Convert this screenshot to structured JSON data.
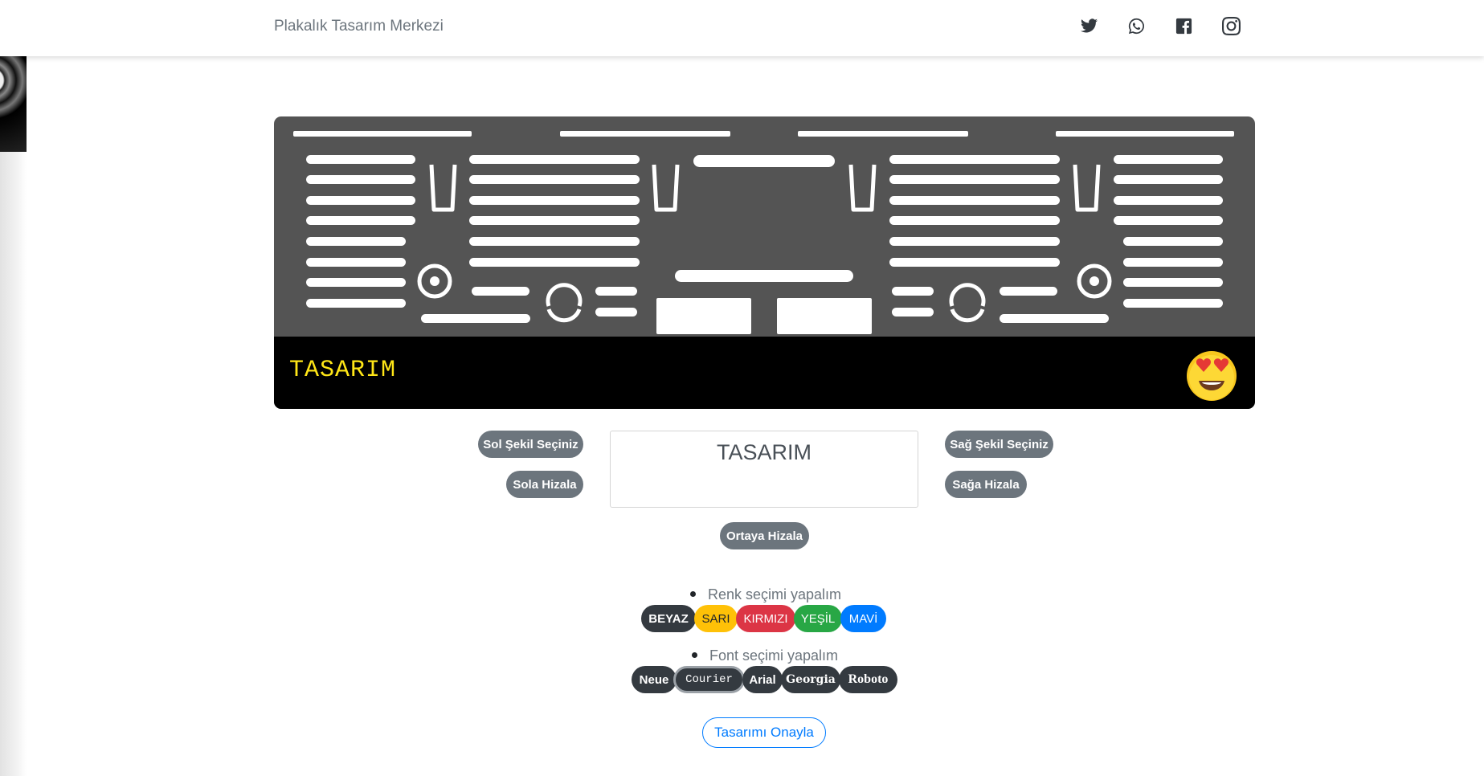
{
  "brand": "Plakalık Tasarım Merkezi",
  "social": [
    "twitter-icon",
    "whatsapp-icon",
    "facebook-icon",
    "instagram-icon"
  ],
  "plate": {
    "text": "TASARIM",
    "text_color": "#ffe617",
    "frame_color": "#545454",
    "strip_color": "#000000",
    "emoji": "heart-eyes-emoji"
  },
  "controls": {
    "left_shape": "Sol Şekil Seçiniz",
    "right_shape": "Sağ Şekil Seçiniz",
    "align_left": "Sola Hizala",
    "align_right": "Sağa Hizala",
    "align_center": "Ortaya Hizala",
    "text_value": "TASARIM"
  },
  "color_section": {
    "label": "Renk seçimi yapalım",
    "options": [
      {
        "label": "BEYAZ",
        "color": "#343a40"
      },
      {
        "label": "SARI",
        "color": "#ffc107"
      },
      {
        "label": "KIRMIZI",
        "color": "#dc3545"
      },
      {
        "label": "YEŞİL",
        "color": "#28a745"
      },
      {
        "label": "MAVİ",
        "color": "#007bff"
      }
    ]
  },
  "font_section": {
    "label": "Font seçimi yapalım",
    "options": [
      "Neue",
      "Courier",
      "Arial",
      "Georgia",
      "Roboto"
    ],
    "selected": "Courier"
  },
  "approve": "Tasarımı Onayla",
  "colors": {
    "secondary": "#6c757d",
    "primary": "#007bff",
    "dark": "#343a40"
  }
}
